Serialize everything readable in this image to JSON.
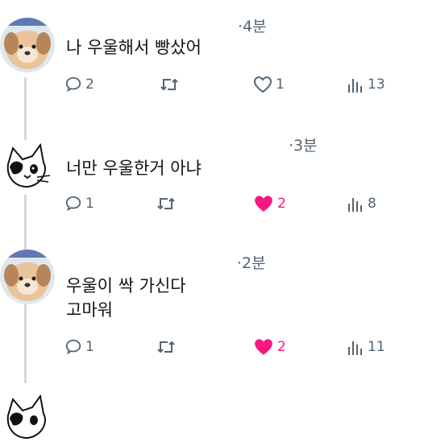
{
  "posts": [
    {
      "author": "puppy",
      "time": "·4분",
      "text": "나 우울해서 빵샀어",
      "replies": "2",
      "retweets": "",
      "likes": "1",
      "liked": false,
      "views": "13"
    },
    {
      "author": "cat",
      "time": "·3분",
      "text": "너만 우울한거 아냐",
      "replies": "1",
      "retweets": "",
      "likes": "2",
      "liked": true,
      "views": "8"
    },
    {
      "author": "puppy",
      "time": "·2분",
      "text": "우울이 싹 가신다\n고마워",
      "replies": "1",
      "retweets": "",
      "likes": "2",
      "liked": true,
      "views": "11"
    }
  ],
  "colors": {
    "icon_gray": "#536471",
    "like_pink": "#f91880",
    "thread_line": "#cfd9de"
  },
  "icons": [
    "reply-icon",
    "retweet-icon",
    "heart-icon",
    "views-icon"
  ]
}
